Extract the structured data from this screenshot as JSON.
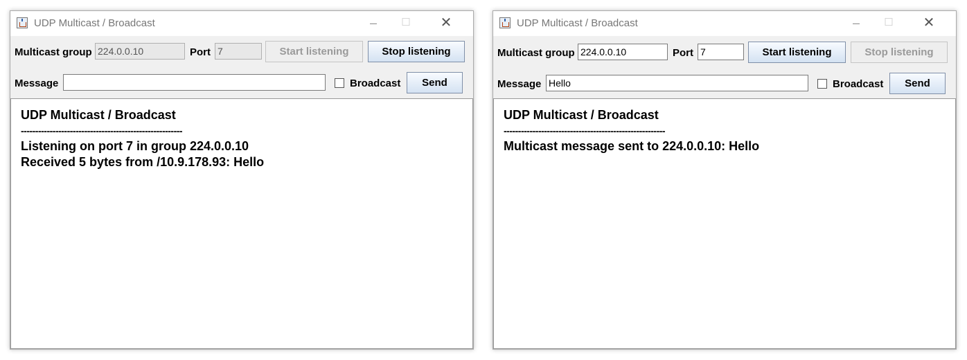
{
  "windows": [
    {
      "title": "UDP Multicast / Broadcast",
      "controls": {
        "minimize": "–",
        "maximize": "☐",
        "close": "✕"
      },
      "group_label": "Multicast group",
      "group_value": "224.0.0.10",
      "port_label": "Port",
      "port_value": "7",
      "start_label": "Start listening",
      "stop_label": "Stop listening",
      "start_enabled": false,
      "stop_enabled": true,
      "message_label": "Message",
      "message_value": "",
      "broadcast_label": "Broadcast",
      "broadcast_checked": false,
      "send_label": "Send",
      "output": {
        "heading": "UDP Multicast / Broadcast",
        "separator": "--------------------------------------------------------",
        "lines": [
          "Listening on port 7 in group 224.0.0.10",
          "Received 5 bytes from /10.9.178.93: Hello"
        ]
      }
    },
    {
      "title": "UDP Multicast / Broadcast",
      "controls": {
        "minimize": "–",
        "maximize": "☐",
        "close": "✕"
      },
      "group_label": "Multicast group",
      "group_value": "224.0.0.10",
      "port_label": "Port",
      "port_value": "7",
      "start_label": "Start listening",
      "stop_label": "Stop listening",
      "start_enabled": true,
      "stop_enabled": false,
      "message_label": "Message",
      "message_value": "Hello",
      "broadcast_label": "Broadcast",
      "broadcast_checked": false,
      "send_label": "Send",
      "output": {
        "heading": "UDP Multicast / Broadcast",
        "separator": "--------------------------------------------------------",
        "lines": [
          "Multicast message sent to 224.0.0.10: Hello"
        ]
      }
    }
  ],
  "icons": {
    "app": "java-cup-icon"
  }
}
